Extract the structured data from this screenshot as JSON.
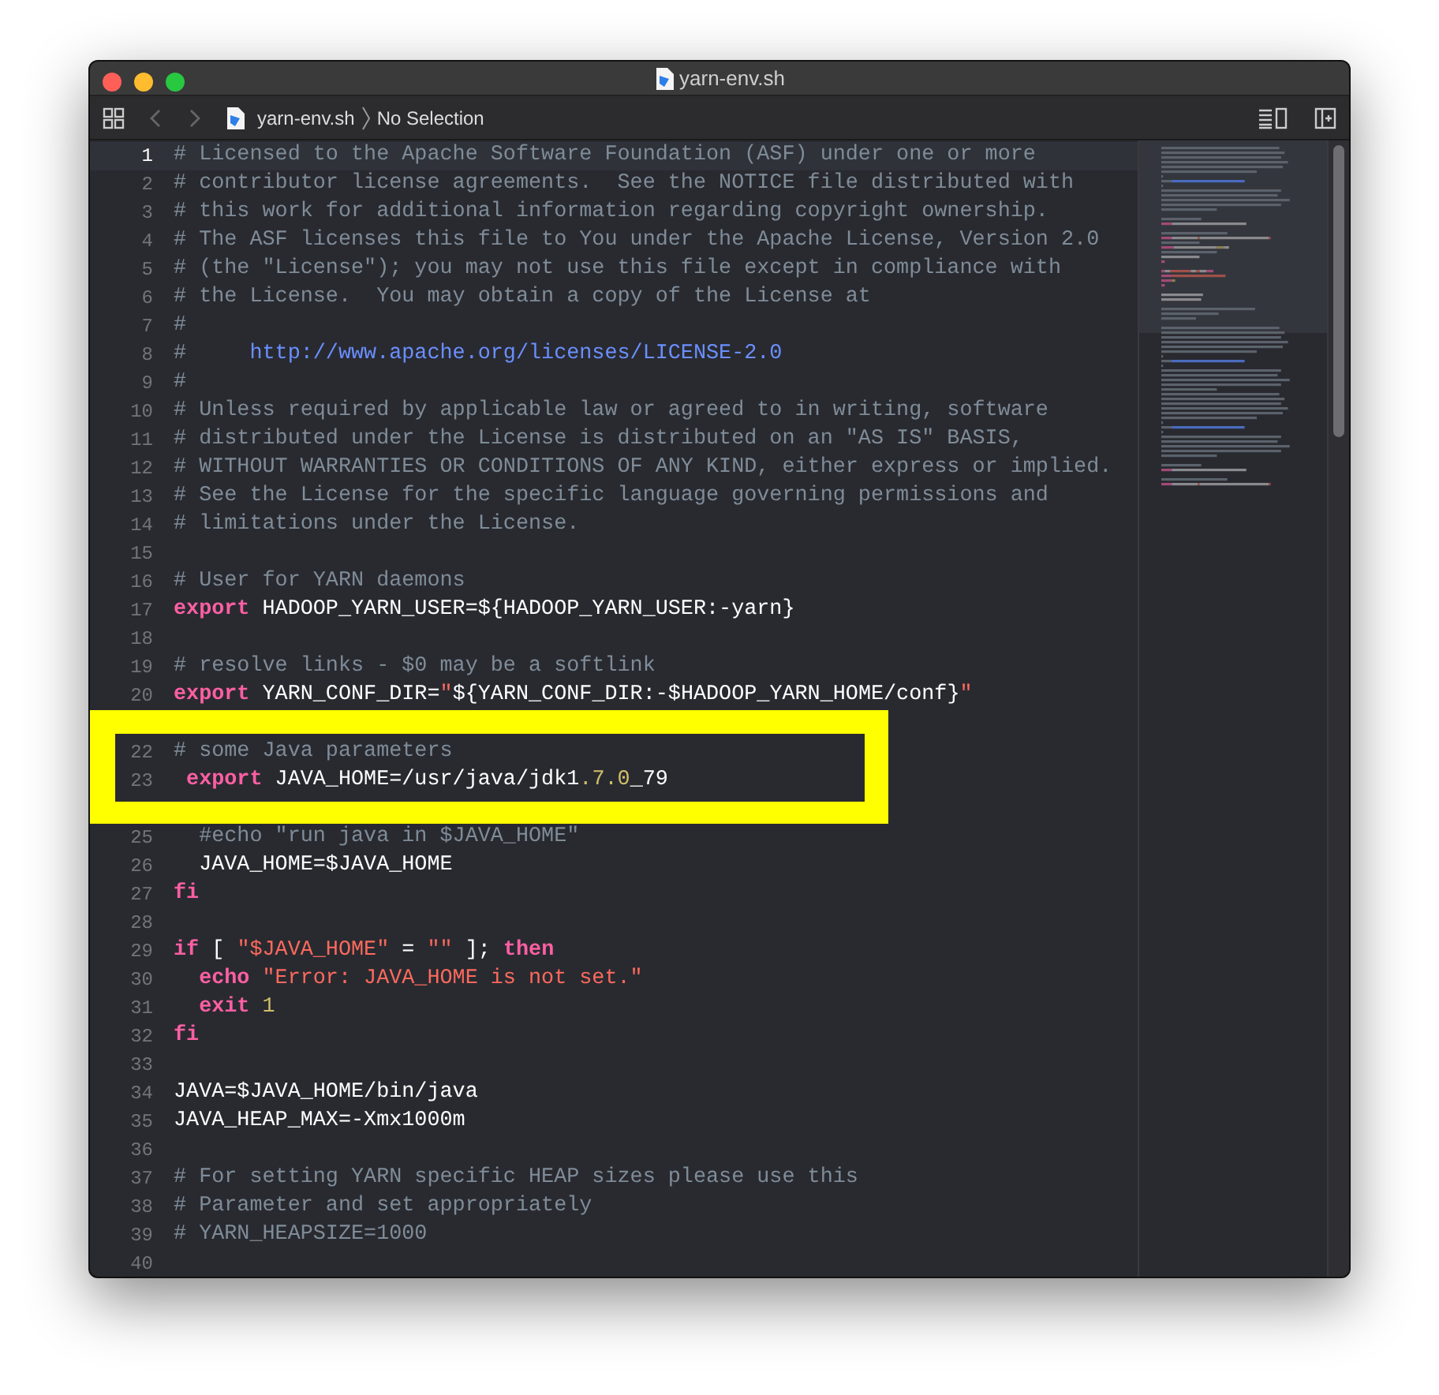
{
  "window": {
    "title": "yarn-env.sh"
  },
  "toolbar": {
    "file": "yarn-env.sh",
    "selection": "No Selection"
  },
  "editor": {
    "lines_before": [
      {
        "number": "1",
        "current": true,
        "tokens": [
          {
            "kind": "comment",
            "text": "# Licensed to the Apache Software Foundation (ASF) under one or more"
          }
        ]
      },
      {
        "number": "2",
        "current": false,
        "tokens": [
          {
            "kind": "comment",
            "text": "# contributor license agreements.  See the NOTICE file distributed with"
          }
        ]
      },
      {
        "number": "3",
        "current": false,
        "tokens": [
          {
            "kind": "comment",
            "text": "# this work for additional information regarding copyright ownership."
          }
        ]
      },
      {
        "number": "4",
        "current": false,
        "tokens": [
          {
            "kind": "comment",
            "text": "# The ASF licenses this file to You under the Apache License, Version 2.0"
          }
        ]
      },
      {
        "number": "5",
        "current": false,
        "tokens": [
          {
            "kind": "comment",
            "text": "# (the \"License\"); you may not use this file except in compliance with"
          }
        ]
      },
      {
        "number": "6",
        "current": false,
        "tokens": [
          {
            "kind": "comment",
            "text": "# the License.  You may obtain a copy of the License at"
          }
        ]
      },
      {
        "number": "7",
        "current": false,
        "tokens": [
          {
            "kind": "comment",
            "text": "#"
          }
        ]
      },
      {
        "number": "8",
        "current": false,
        "tokens": [
          {
            "kind": "comment",
            "text": "#     "
          },
          {
            "kind": "url",
            "text": "http://www.apache.org/licenses/LICENSE-2.0"
          }
        ]
      },
      {
        "number": "9",
        "current": false,
        "tokens": [
          {
            "kind": "comment",
            "text": "#"
          }
        ]
      },
      {
        "number": "10",
        "current": false,
        "tokens": [
          {
            "kind": "comment",
            "text": "# Unless required by applicable law or agreed to in writing, software"
          }
        ]
      },
      {
        "number": "11",
        "current": false,
        "tokens": [
          {
            "kind": "comment",
            "text": "# distributed under the License is distributed on an \"AS IS\" BASIS,"
          }
        ]
      },
      {
        "number": "12",
        "current": false,
        "tokens": [
          {
            "kind": "comment",
            "text": "# WITHOUT WARRANTIES OR CONDITIONS OF ANY KIND, either express or implied."
          }
        ]
      },
      {
        "number": "13",
        "current": false,
        "tokens": [
          {
            "kind": "comment",
            "text": "# See the License for the specific language governing permissions and"
          }
        ]
      },
      {
        "number": "14",
        "current": false,
        "tokens": [
          {
            "kind": "comment",
            "text": "# limitations under the License."
          }
        ]
      },
      {
        "number": "15",
        "current": false
      },
      {
        "number": "16",
        "current": false,
        "tokens": [
          {
            "kind": "comment",
            "text": "# User for YARN daemons"
          }
        ]
      },
      {
        "number": "17",
        "current": false,
        "tokens": [
          {
            "kind": "keyword",
            "text": "export"
          },
          {
            "kind": "plain",
            "text": " HADOOP_YARN_USER=${HADOOP_YARN_USER:-yarn}"
          }
        ]
      },
      {
        "number": "18",
        "current": false
      },
      {
        "number": "19",
        "current": false,
        "tokens": [
          {
            "kind": "comment",
            "text": "# resolve links - $0 may be a softlink"
          }
        ]
      },
      {
        "number": "20",
        "current": false,
        "tokens": [
          {
            "kind": "keyword",
            "text": "export"
          },
          {
            "kind": "plain",
            "text": " YARN_CONF_DIR="
          },
          {
            "kind": "string",
            "text": "\""
          },
          {
            "kind": "plain",
            "text": "${YARN_CONF_DIR:-$HADOOP_YARN_HOME/conf}"
          },
          {
            "kind": "string",
            "text": "\""
          }
        ]
      }
    ],
    "callout": {
      "lines": [
        {
          "number": "22",
          "current": false,
          "tokens": [
            {
              "kind": "comment",
              "text": "# some Java parameters"
            }
          ]
        },
        {
          "number": "23",
          "current": false,
          "tokens": [
            {
              "kind": "keyword",
              "text": " export"
            },
            {
              "kind": "plain",
              "text": " JAVA_HOME=/usr/java/jdk1"
            },
            {
              "kind": "number",
              "text": ".7.0"
            },
            {
              "kind": "plain",
              "text": "_79"
            }
          ]
        }
      ]
    },
    "lines_after": [
      {
        "number": "25",
        "current": false,
        "tokens": [
          {
            "kind": "comment",
            "text": "  #echo \"run java in $JAVA_HOME\""
          }
        ]
      },
      {
        "number": "26",
        "current": false,
        "tokens": [
          {
            "kind": "plain",
            "text": "  JAVA_HOME=$JAVA_HOME"
          }
        ]
      },
      {
        "number": "27",
        "current": false,
        "tokens": [
          {
            "kind": "keyword",
            "text": "fi"
          }
        ]
      },
      {
        "number": "28",
        "current": false
      },
      {
        "number": "29",
        "current": false,
        "tokens": [
          {
            "kind": "keyword",
            "text": "if"
          },
          {
            "kind": "plain",
            "text": " [ "
          },
          {
            "kind": "string",
            "text": "\"$JAVA_HOME\""
          },
          {
            "kind": "plain",
            "text": " = "
          },
          {
            "kind": "string",
            "text": "\"\""
          },
          {
            "kind": "plain",
            "text": " ]; "
          },
          {
            "kind": "keyword",
            "text": "then"
          }
        ]
      },
      {
        "number": "30",
        "current": false,
        "tokens": [
          {
            "kind": "keyword",
            "text": "  echo"
          },
          {
            "kind": "string",
            "text": " \"Error: JAVA_HOME is not set.\""
          }
        ]
      },
      {
        "number": "31",
        "current": false,
        "tokens": [
          {
            "kind": "keyword",
            "text": "  exit"
          },
          {
            "kind": "number",
            "text": " 1"
          }
        ]
      },
      {
        "number": "32",
        "current": false,
        "tokens": [
          {
            "kind": "keyword",
            "text": "fi"
          }
        ]
      },
      {
        "number": "33",
        "current": false
      },
      {
        "number": "34",
        "current": false,
        "tokens": [
          {
            "kind": "plain",
            "text": "JAVA=$JAVA_HOME/bin/java"
          }
        ]
      },
      {
        "number": "35",
        "current": false,
        "tokens": [
          {
            "kind": "plain",
            "text": "JAVA_HEAP_MAX=-Xmx1000m"
          }
        ]
      },
      {
        "number": "36",
        "current": false
      },
      {
        "number": "37",
        "current": false,
        "tokens": [
          {
            "kind": "comment",
            "text": "# For setting YARN specific HEAP sizes please use this"
          }
        ]
      },
      {
        "number": "38",
        "current": false,
        "tokens": [
          {
            "kind": "comment",
            "text": "# Parameter and set appropriately"
          }
        ]
      },
      {
        "number": "39",
        "current": false,
        "tokens": [
          {
            "kind": "comment",
            "text": "# YARN_HEAPSIZE=1000"
          }
        ]
      },
      {
        "number": "40",
        "current": false
      }
    ]
  }
}
